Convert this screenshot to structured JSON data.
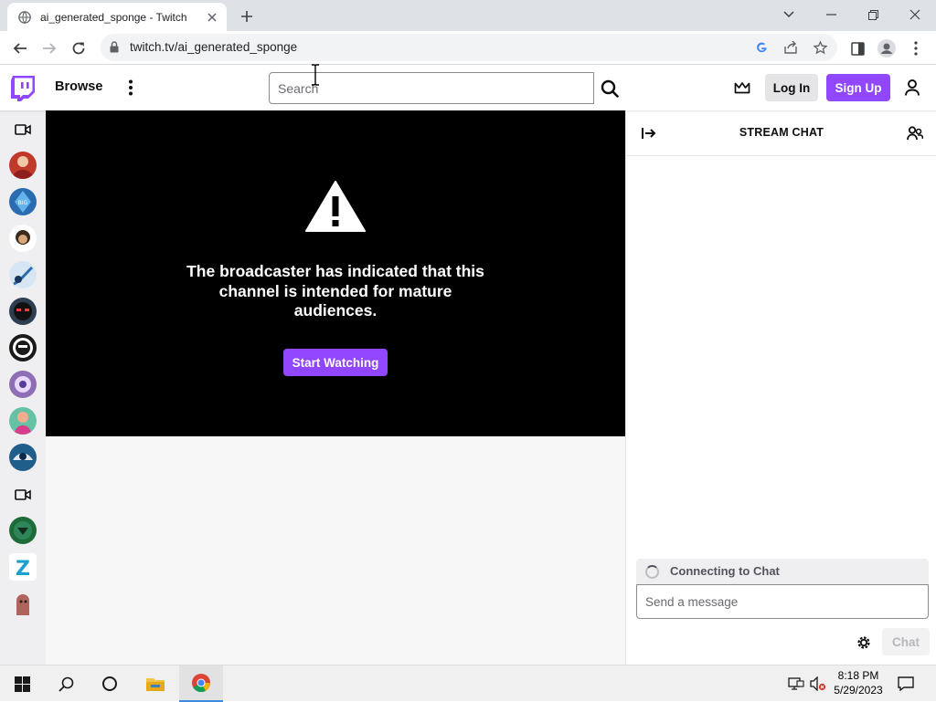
{
  "browser": {
    "tab_title": "ai_generated_sponge - Twitch",
    "url": "twitch.tv/ai_generated_sponge"
  },
  "twitch": {
    "nav": {
      "browse_label": "Browse",
      "search_placeholder": "Search",
      "login_label": "Log In",
      "signup_label": "Sign Up"
    },
    "player": {
      "mature_message": "The broadcaster has indicated that this channel is intended for mature audiences.",
      "start_button": "Start Watching"
    },
    "chat": {
      "title": "STREAM CHAT",
      "status": "Connecting to Chat",
      "message_placeholder": "Send a message",
      "chat_button": "Chat"
    },
    "rail": {
      "items": [
        {
          "kind": "camera"
        },
        {
          "kind": "avatar",
          "color": "#c0392b"
        },
        {
          "kind": "avatar",
          "color": "#2b6cb0"
        },
        {
          "kind": "avatar",
          "color": "#3a2a20"
        },
        {
          "kind": "avatar",
          "color": "#d8e6f4"
        },
        {
          "kind": "avatar",
          "color": "#2c3e50"
        },
        {
          "kind": "avatar",
          "color": "#1a1a1a"
        },
        {
          "kind": "avatar",
          "color": "#8e6fb5"
        },
        {
          "kind": "avatar",
          "color": "#66c2a5"
        },
        {
          "kind": "avatar",
          "color": "#1f5d8a"
        },
        {
          "kind": "camera"
        },
        {
          "kind": "avatar",
          "color": "#1e6b3a"
        },
        {
          "kind": "avatar",
          "color": "#1b9fcf"
        },
        {
          "kind": "avatar",
          "color": "#b0645c"
        }
      ]
    }
  },
  "taskbar": {
    "time": "8:18 PM",
    "date": "5/29/2023"
  },
  "colors": {
    "twitch_purple": "#9147ff",
    "player_bg": "#000000",
    "rail_bg": "#efeff1"
  }
}
